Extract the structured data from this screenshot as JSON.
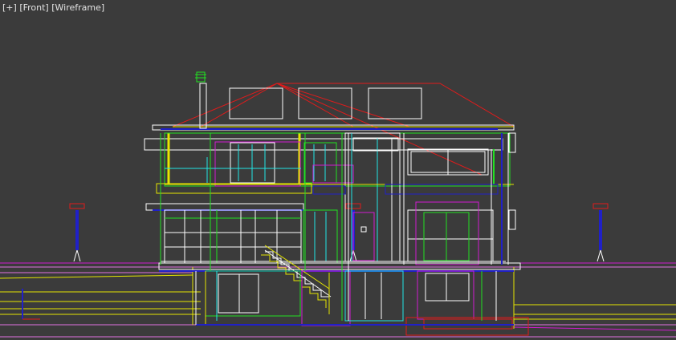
{
  "viewport": {
    "plus_label": "[+]",
    "view_label": "[Front]",
    "shading_label": "[Wireframe]"
  },
  "colors": {
    "background": "#3b3b3b",
    "label_text": "#e2e2e2",
    "white": "#ffffff",
    "red": "#e01b1b",
    "yellow": "#e6e600",
    "green": "#22e022",
    "cyan": "#22e6e6",
    "blue": "#2020c8",
    "magenta": "#d21bd2",
    "light_magenta": "#e070e0"
  }
}
